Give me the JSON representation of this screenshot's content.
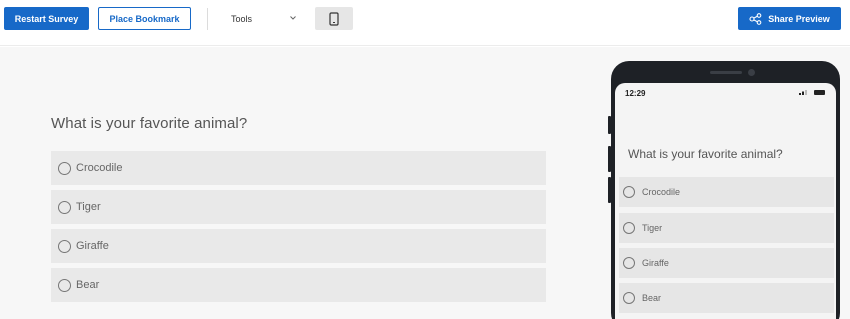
{
  "toolbar": {
    "restart_label": "Restart Survey",
    "bookmark_label": "Place Bookmark",
    "tools_label": "Tools",
    "share_label": "Share Preview"
  },
  "survey": {
    "question": "What is your favorite animal?",
    "choices": [
      "Crocodile",
      "Tiger",
      "Giraffe",
      "Bear"
    ]
  },
  "phone": {
    "time": "12:29",
    "question": "What is your favorite animal?",
    "choices": [
      "Crocodile",
      "Tiger",
      "Giraffe",
      "Bear"
    ]
  },
  "colors": {
    "primary": "#1769c8",
    "choice_bg": "#e9e9e9",
    "phone_frame": "#1e2126"
  },
  "icons": {
    "tools_dropdown": "chevron-down-icon",
    "device_toggle": "mobile-phone-icon",
    "share": "share-nodes-icon"
  }
}
